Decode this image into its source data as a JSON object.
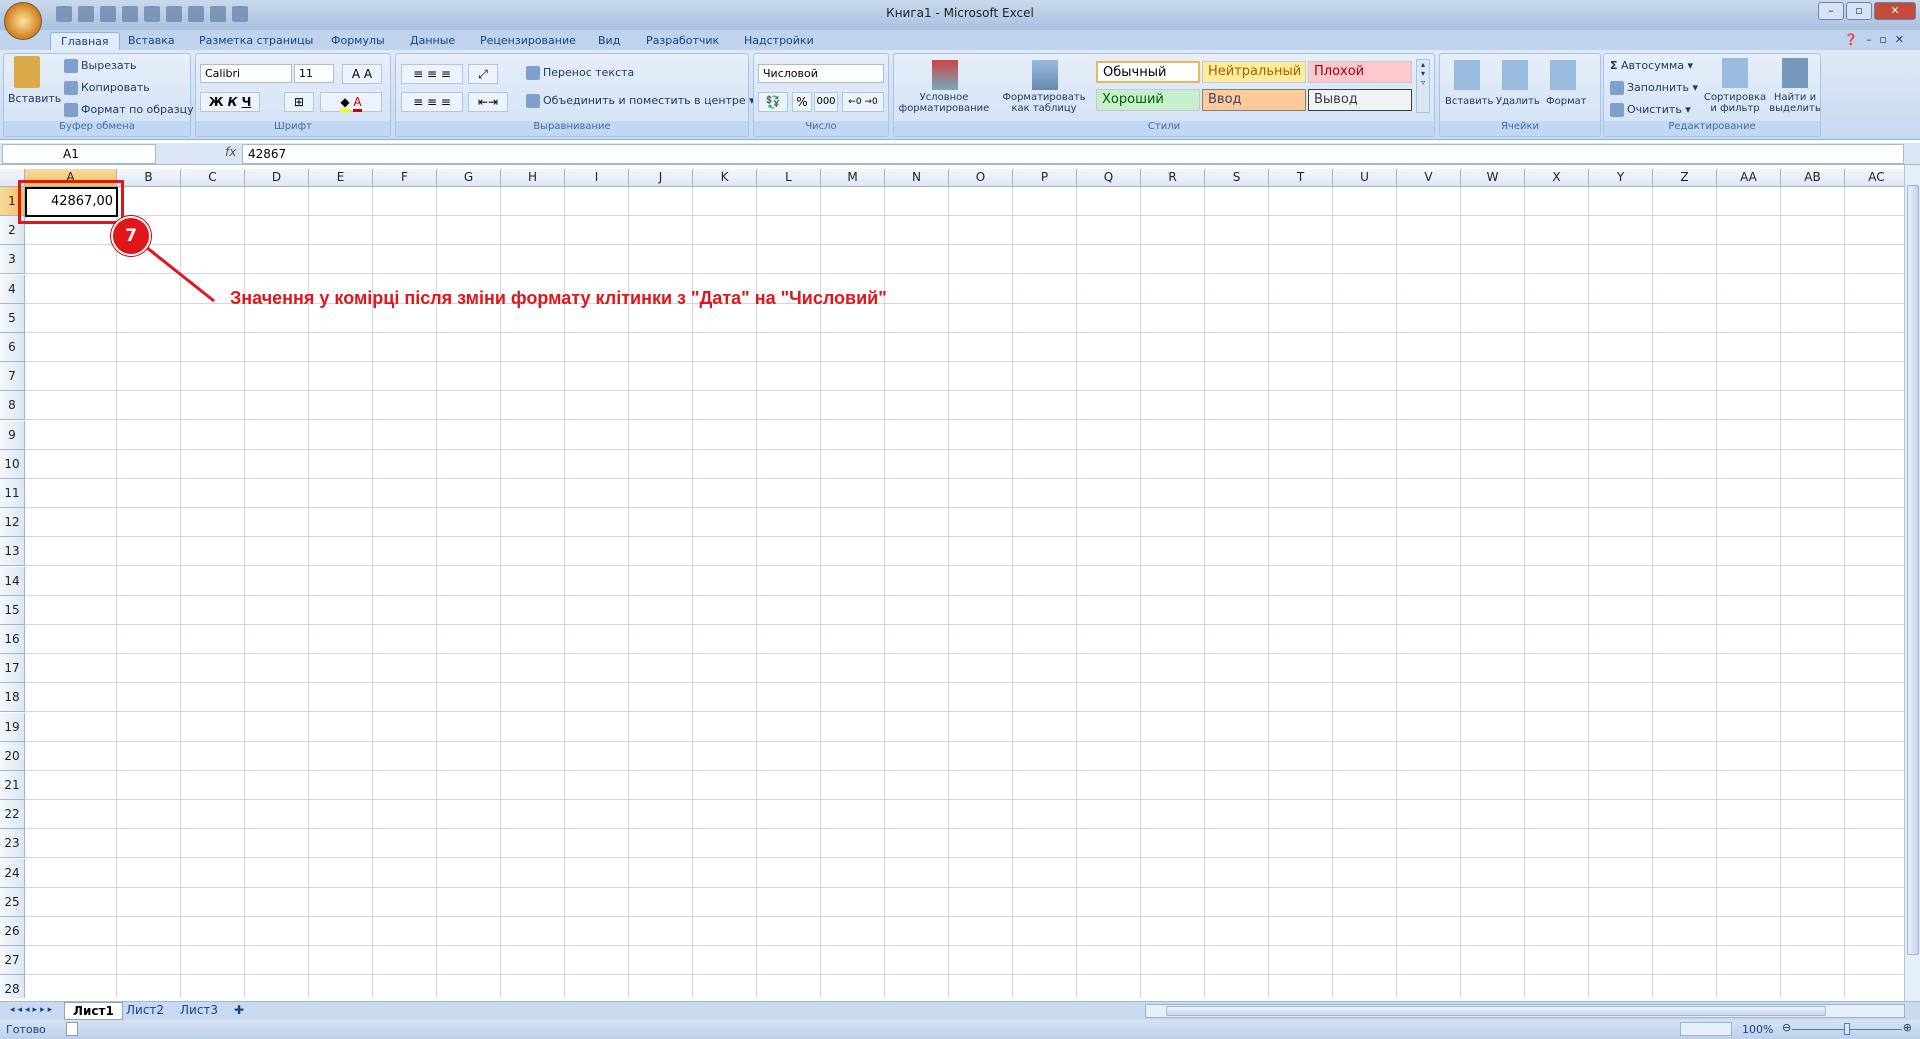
{
  "window": {
    "title": "Книга1 - Microsoft Excel"
  },
  "tabs": [
    "Главная",
    "Вставка",
    "Разметка страницы",
    "Формулы",
    "Данные",
    "Рецензирование",
    "Вид",
    "Разработчик",
    "Надстройки"
  ],
  "clipboard": {
    "paste": "Вставить",
    "cut": "Вырезать",
    "copy": "Копировать",
    "format_painter": "Формат по образцу",
    "label": "Буфер обмена"
  },
  "font": {
    "name": "Calibri",
    "size": "11",
    "bold": "Ж",
    "italic": "К",
    "underline": "Ч",
    "label": "Шрифт"
  },
  "alignment": {
    "wrap": "Перенос текста",
    "merge": "Объединить и поместить в центре",
    "label": "Выравнивание"
  },
  "number": {
    "format": "Числовой",
    "percent": "%",
    "thousands": "000",
    "label": "Число"
  },
  "styles": {
    "conditional": "Условное форматирование",
    "as_table": "Форматировать как таблицу",
    "normal": "Обычный",
    "neutral": "Нейтральный",
    "bad": "Плохой",
    "good": "Хороший",
    "input": "Ввод",
    "output": "Вывод",
    "label": "Стили"
  },
  "cells": {
    "insert": "Вставить",
    "delete": "Удалить",
    "format": "Формат",
    "label": "Ячейки"
  },
  "editing": {
    "autosum": "Автосумма",
    "fill": "Заполнить",
    "clear": "Очистить",
    "sort": "Сортировка и фильтр",
    "find": "Найти и выделить",
    "label": "Редактирование"
  },
  "formula_bar": {
    "name_box": "A1",
    "fx": "fx",
    "value": "42867"
  },
  "columns": [
    "A",
    "B",
    "C",
    "D",
    "E",
    "F",
    "G",
    "H",
    "I",
    "J",
    "K",
    "L",
    "M",
    "N",
    "O",
    "P",
    "Q",
    "R",
    "S",
    "T",
    "U",
    "V",
    "W",
    "X",
    "Y",
    "Z",
    "AA",
    "AB",
    "AC"
  ],
  "rows": [
    "1",
    "2",
    "3",
    "4",
    "5",
    "6",
    "7",
    "8",
    "9",
    "10",
    "11",
    "12",
    "13",
    "14",
    "15",
    "16",
    "17",
    "18",
    "19",
    "20",
    "21",
    "22",
    "23",
    "24",
    "25",
    "26",
    "27",
    "28"
  ],
  "cell_a1": "42867,00",
  "annotation": {
    "number": "7",
    "text": "Значення у комірці після зміни формату клітинки з \"Дата\" на \"Числовий\"",
    "color": "#e0161b"
  },
  "sheets": [
    "Лист1",
    "Лист2",
    "Лист3"
  ],
  "status": {
    "ready": "Готово",
    "zoom": "100%"
  }
}
